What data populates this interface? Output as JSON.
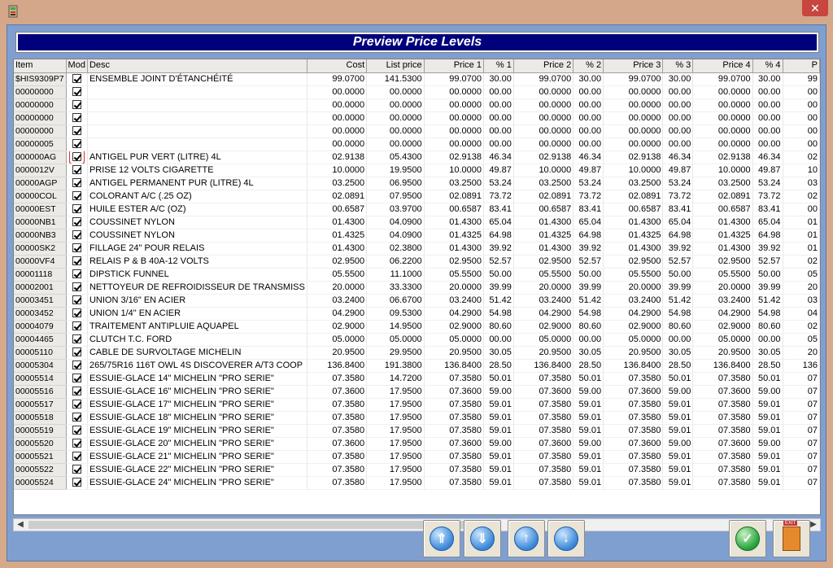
{
  "window": {
    "close_label": "✕"
  },
  "header": {
    "title": "Preview Price Levels"
  },
  "columns": [
    "Item",
    "Mod",
    "Desc",
    "Cost",
    "List price",
    "Price 1",
    "% 1",
    "Price 2",
    "% 2",
    "Price 3",
    "% 3",
    "Price 4",
    "% 4",
    "P"
  ],
  "rows": [
    [
      "$HIS9309P7",
      true,
      "ENSEMBLE JOINT D'ÉTANCHÉITÉ",
      "99.0700",
      "141.5300",
      "99.0700",
      "30.00",
      "99.0700",
      "30.00",
      "99.0700",
      "30.00",
      "99.0700",
      "30.00",
      "99"
    ],
    [
      "00000000",
      true,
      "",
      "00.0000",
      "00.0000",
      "00.0000",
      "00.00",
      "00.0000",
      "00.00",
      "00.0000",
      "00.00",
      "00.0000",
      "00.00",
      "00"
    ],
    [
      "00000000",
      true,
      "",
      "00.0000",
      "00.0000",
      "00.0000",
      "00.00",
      "00.0000",
      "00.00",
      "00.0000",
      "00.00",
      "00.0000",
      "00.00",
      "00"
    ],
    [
      "00000000",
      true,
      "",
      "00.0000",
      "00.0000",
      "00.0000",
      "00.00",
      "00.0000",
      "00.00",
      "00.0000",
      "00.00",
      "00.0000",
      "00.00",
      "00"
    ],
    [
      "00000000",
      true,
      "",
      "00.0000",
      "00.0000",
      "00.0000",
      "00.00",
      "00.0000",
      "00.00",
      "00.0000",
      "00.00",
      "00.0000",
      "00.00",
      "00"
    ],
    [
      "00000005",
      true,
      "",
      "00.0000",
      "00.0000",
      "00.0000",
      "00.00",
      "00.0000",
      "00.00",
      "00.0000",
      "00.00",
      "00.0000",
      "00.00",
      "00"
    ],
    [
      "000000AG",
      true,
      "ANTIGEL PUR VERT (LITRE)  4L",
      "02.9138",
      "05.4300",
      "02.9138",
      "46.34",
      "02.9138",
      "46.34",
      "02.9138",
      "46.34",
      "02.9138",
      "46.34",
      "02"
    ],
    [
      "0000012V",
      true,
      "PRISE 12 VOLTS CIGARETTE",
      "10.0000",
      "19.9500",
      "10.0000",
      "49.87",
      "10.0000",
      "49.87",
      "10.0000",
      "49.87",
      "10.0000",
      "49.87",
      "10"
    ],
    [
      "00000AGP",
      true,
      "ANTIGEL PERMANENT PUR (LITRE)  4L",
      "03.2500",
      "06.9500",
      "03.2500",
      "53.24",
      "03.2500",
      "53.24",
      "03.2500",
      "53.24",
      "03.2500",
      "53.24",
      "03"
    ],
    [
      "00000COL",
      true,
      "COLORANT A/C (.25 OZ)",
      "02.0891",
      "07.9500",
      "02.0891",
      "73.72",
      "02.0891",
      "73.72",
      "02.0891",
      "73.72",
      "02.0891",
      "73.72",
      "02"
    ],
    [
      "00000EST",
      true,
      "HUILE ESTER A/C (OZ)",
      "00.6587",
      "03.9700",
      "00.6587",
      "83.41",
      "00.6587",
      "83.41",
      "00.6587",
      "83.41",
      "00.6587",
      "83.41",
      "00"
    ],
    [
      "00000NB1",
      true,
      "COUSSINET NYLON",
      "01.4300",
      "04.0900",
      "01.4300",
      "65.04",
      "01.4300",
      "65.04",
      "01.4300",
      "65.04",
      "01.4300",
      "65.04",
      "01"
    ],
    [
      "00000NB3",
      true,
      "COUSSINET NYLON",
      "01.4325",
      "04.0900",
      "01.4325",
      "64.98",
      "01.4325",
      "64.98",
      "01.4325",
      "64.98",
      "01.4325",
      "64.98",
      "01"
    ],
    [
      "00000SK2",
      true,
      "FILLAGE 24\" POUR RELAIS",
      "01.4300",
      "02.3800",
      "01.4300",
      "39.92",
      "01.4300",
      "39.92",
      "01.4300",
      "39.92",
      "01.4300",
      "39.92",
      "01"
    ],
    [
      "00000VF4",
      true,
      "RELAIS P & B 40A-12 VOLTS",
      "02.9500",
      "06.2200",
      "02.9500",
      "52.57",
      "02.9500",
      "52.57",
      "02.9500",
      "52.57",
      "02.9500",
      "52.57",
      "02"
    ],
    [
      "00001118",
      true,
      "DIPSTICK FUNNEL",
      "05.5500",
      "11.1000",
      "05.5500",
      "50.00",
      "05.5500",
      "50.00",
      "05.5500",
      "50.00",
      "05.5500",
      "50.00",
      "05"
    ],
    [
      "00002001",
      true,
      "NETTOYEUR DE REFROIDISSEUR DE TRANSMISS",
      "20.0000",
      "33.3300",
      "20.0000",
      "39.99",
      "20.0000",
      "39.99",
      "20.0000",
      "39.99",
      "20.0000",
      "39.99",
      "20"
    ],
    [
      "00003451",
      true,
      "UNION 3/16\" EN ACIER",
      "03.2400",
      "06.6700",
      "03.2400",
      "51.42",
      "03.2400",
      "51.42",
      "03.2400",
      "51.42",
      "03.2400",
      "51.42",
      "03"
    ],
    [
      "00003452",
      true,
      "UNION 1/4\" EN ACIER",
      "04.2900",
      "09.5300",
      "04.2900",
      "54.98",
      "04.2900",
      "54.98",
      "04.2900",
      "54.98",
      "04.2900",
      "54.98",
      "04"
    ],
    [
      "00004079",
      true,
      "TRAITEMENT ANTIPLUIE AQUAPEL",
      "02.9000",
      "14.9500",
      "02.9000",
      "80.60",
      "02.9000",
      "80.60",
      "02.9000",
      "80.60",
      "02.9000",
      "80.60",
      "02"
    ],
    [
      "00004465",
      true,
      "CLUTCH T.C. FORD",
      "05.0000",
      "05.0000",
      "05.0000",
      "00.00",
      "05.0000",
      "00.00",
      "05.0000",
      "00.00",
      "05.0000",
      "00.00",
      "05"
    ],
    [
      "00005110",
      true,
      "CABLE DE SURVOLTAGE MICHELIN",
      "20.9500",
      "29.9500",
      "20.9500",
      "30.05",
      "20.9500",
      "30.05",
      "20.9500",
      "30.05",
      "20.9500",
      "30.05",
      "20"
    ],
    [
      "00005304",
      true,
      "265/75R16 116T OWL 4S DISCOVERER A/T3 COOP",
      "136.8400",
      "191.3800",
      "136.8400",
      "28.50",
      "136.8400",
      "28.50",
      "136.8400",
      "28.50",
      "136.8400",
      "28.50",
      "136"
    ],
    [
      "00005514",
      true,
      "ESSUIE-GLACE 14\" MICHELIN \"PRO SERIE\"",
      "07.3580",
      "14.7200",
      "07.3580",
      "50.01",
      "07.3580",
      "50.01",
      "07.3580",
      "50.01",
      "07.3580",
      "50.01",
      "07"
    ],
    [
      "00005516",
      true,
      "ESSUIE-GLACE 16\" MICHELIN \"PRO SERIE\"",
      "07.3600",
      "17.9500",
      "07.3600",
      "59.00",
      "07.3600",
      "59.00",
      "07.3600",
      "59.00",
      "07.3600",
      "59.00",
      "07"
    ],
    [
      "00005517",
      true,
      "ESSUIE-GLACE 17\" MICHELIN \"PRO SERIE\"",
      "07.3580",
      "17.9500",
      "07.3580",
      "59.01",
      "07.3580",
      "59.01",
      "07.3580",
      "59.01",
      "07.3580",
      "59.01",
      "07"
    ],
    [
      "00005518",
      true,
      "ESSUIE-GLACE 18\" MICHELIN \"PRO SERIE\"",
      "07.3580",
      "17.9500",
      "07.3580",
      "59.01",
      "07.3580",
      "59.01",
      "07.3580",
      "59.01",
      "07.3580",
      "59.01",
      "07"
    ],
    [
      "00005519",
      true,
      "ESSUIE-GLACE 19\" MICHELIN \"PRO SERIE\"",
      "07.3580",
      "17.9500",
      "07.3580",
      "59.01",
      "07.3580",
      "59.01",
      "07.3580",
      "59.01",
      "07.3580",
      "59.01",
      "07"
    ],
    [
      "00005520",
      true,
      "ESSUIE-GLACE 20\" MICHELIN \"PRO SERIE\"",
      "07.3600",
      "17.9500",
      "07.3600",
      "59.00",
      "07.3600",
      "59.00",
      "07.3600",
      "59.00",
      "07.3600",
      "59.00",
      "07"
    ],
    [
      "00005521",
      true,
      "ESSUIE-GLACE 21\" MICHELIN \"PRO SERIE\"",
      "07.3580",
      "17.9500",
      "07.3580",
      "59.01",
      "07.3580",
      "59.01",
      "07.3580",
      "59.01",
      "07.3580",
      "59.01",
      "07"
    ],
    [
      "00005522",
      true,
      "ESSUIE-GLACE 22\" MICHELIN \"PRO SERIE\"",
      "07.3580",
      "17.9500",
      "07.3580",
      "59.01",
      "07.3580",
      "59.01",
      "07.3580",
      "59.01",
      "07.3580",
      "59.01",
      "07"
    ],
    [
      "00005524",
      true,
      "ESSUIE-GLACE 24\" MICHELIN \"PRO SERIE\"",
      "07.3580",
      "17.9500",
      "07.3580",
      "59.01",
      "07.3580",
      "59.01",
      "07.3580",
      "59.01",
      "07.3580",
      "59.01",
      "07"
    ]
  ],
  "highlighted_row": 6,
  "buttons": [
    {
      "name": "first-page-button",
      "icon": "arrow-up-page-icon"
    },
    {
      "name": "last-page-button",
      "icon": "arrow-down-page-icon"
    },
    {
      "name": "previous-button",
      "icon": "arrow-up-icon"
    },
    {
      "name": "next-button",
      "icon": "arrow-down-icon"
    },
    {
      "name": "accept-button",
      "icon": "check-icon"
    },
    {
      "name": "exit-button",
      "icon": "exit-door-icon",
      "label": "EXIT"
    }
  ],
  "colors": {
    "title_bar": "#d4a78a",
    "client": "#7f9fd1",
    "banner": "#00007c",
    "close": "#c7463f"
  }
}
